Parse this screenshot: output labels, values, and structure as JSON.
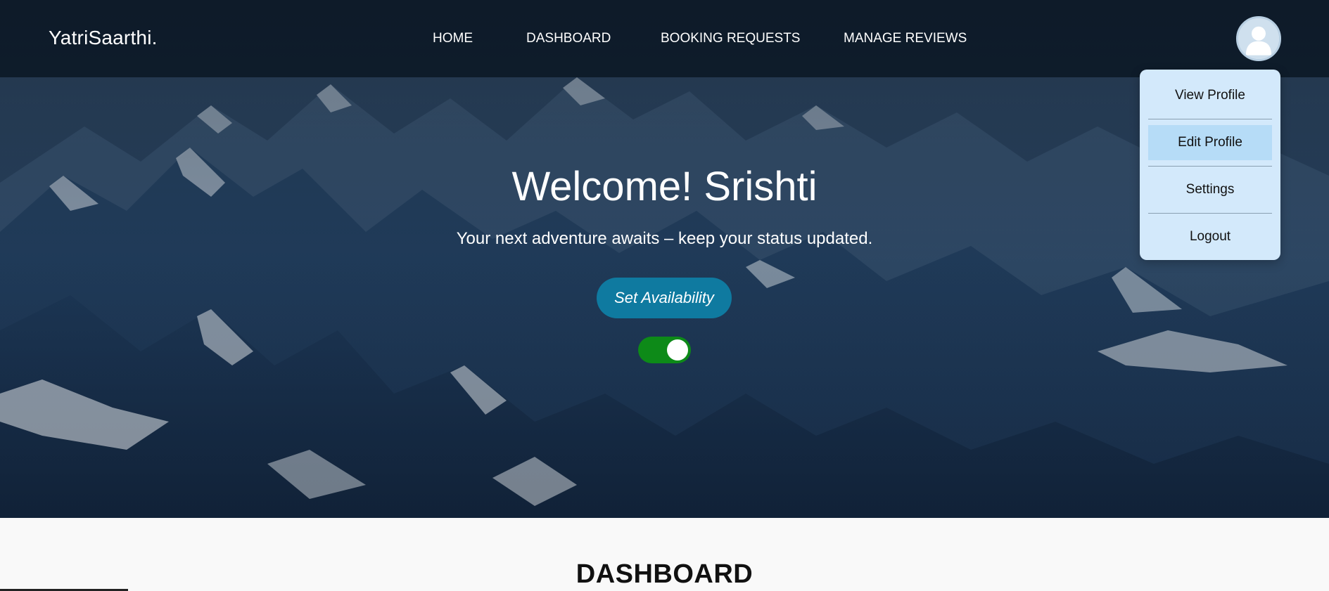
{
  "navbar": {
    "brand": "YatriSaarthi.",
    "links": [
      "HOME",
      "DASHBOARD",
      "BOOKING REQUESTS",
      "MANAGE REVIEWS"
    ],
    "avatar_icon": "user-avatar-icon"
  },
  "dropdown": {
    "items": [
      "View Profile",
      "Edit Profile",
      "Settings",
      "Logout"
    ],
    "active_index": 1
  },
  "hero": {
    "welcome": "Welcome! Srishti",
    "subtitle": "Your next adventure awaits – keep your status updated.",
    "set_availability_label": "Set Availability",
    "availability_on": true
  },
  "dashboard": {
    "title": "DASHBOARD"
  },
  "colors": {
    "button": "#0f7aa0",
    "toggle_on": "#0d8a18",
    "dropdown_bg": "#d3e9fb",
    "dropdown_active": "#b6dcf7"
  }
}
